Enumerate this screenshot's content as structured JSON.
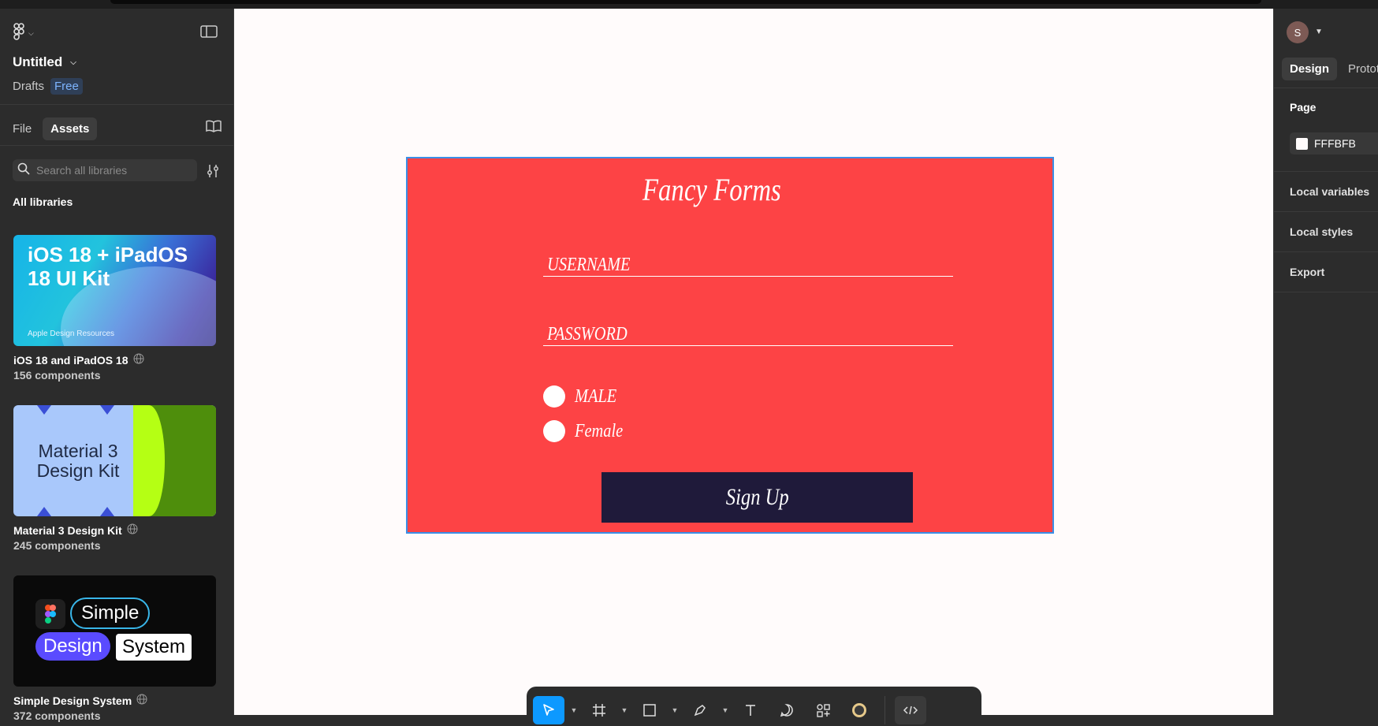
{
  "file": {
    "title": "Untitled",
    "location": "Drafts",
    "plan_badge": "Free"
  },
  "left_tabs": {
    "file": "File",
    "assets": "Assets"
  },
  "search": {
    "placeholder": "Search all libraries"
  },
  "libraries": {
    "heading": "All libraries",
    "items": [
      {
        "name": "iOS 18 and iPadOS 18",
        "count": "156 components",
        "thumb_title": "iOS 18 + iPadOS 18 UI Kit",
        "thumb_footer": "Apple Design Resources"
      },
      {
        "name": "Material 3 Design Kit",
        "count": "245 components",
        "thumb_title": "Material 3 Design Kit"
      },
      {
        "name": "Simple Design System",
        "count": "372 components",
        "thumb_words": [
          "Simple",
          "Design",
          "System"
        ]
      }
    ]
  },
  "frame": {
    "title": "Fancy Forms",
    "username_placeholder": "USERNAME",
    "password_placeholder": "PASSWORD",
    "gender_options": [
      "MALE",
      "Female"
    ],
    "submit_label": "Sign Up",
    "colors": {
      "background": "#fd4345",
      "button": "#1f1a3a",
      "selection": "#3b8ee6"
    }
  },
  "canvas": {
    "background": "#fffbfb"
  },
  "toolbar": {
    "tools": [
      "move-icon",
      "frame-icon",
      "rectangle-icon",
      "pen-icon",
      "text-icon",
      "comment-icon",
      "actions-icon",
      "ai-icon",
      "dev-mode-icon"
    ]
  },
  "right_panel": {
    "avatar_initial": "S",
    "tabs": {
      "design": "Design",
      "prototype": "Protot"
    },
    "page_heading": "Page",
    "page_color": "FFFBFB",
    "sections": [
      "Local variables",
      "Local styles",
      "Export"
    ]
  }
}
